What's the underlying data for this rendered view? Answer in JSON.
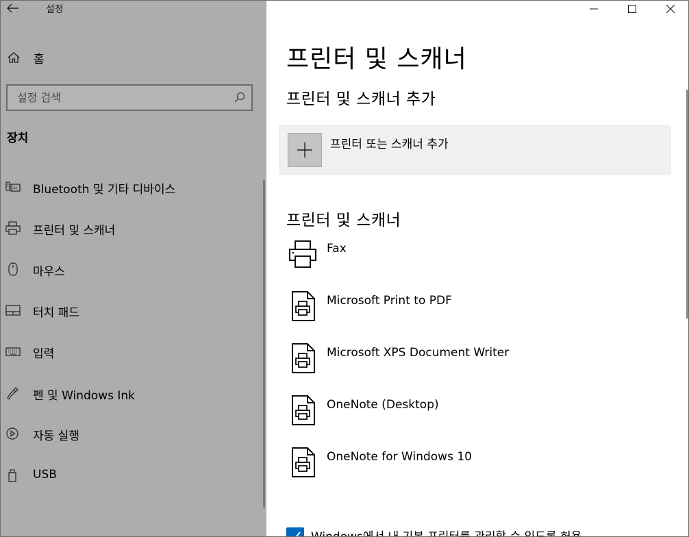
{
  "window": {
    "title": "설정",
    "accent_color": "#0067c0",
    "sidebar_color": "#adadad"
  },
  "sidebar": {
    "home_label": "홈",
    "search_placeholder": "설정 검색",
    "section_title": "장치",
    "items": [
      {
        "label": "Bluetooth 및 기타 디바이스",
        "icon": "bluetooth-devices-icon"
      },
      {
        "label": "프린터 및 스캐너",
        "icon": "printer-icon"
      },
      {
        "label": "마우스",
        "icon": "mouse-icon"
      },
      {
        "label": "터치 패드",
        "icon": "touchpad-icon"
      },
      {
        "label": "입력",
        "icon": "keyboard-icon"
      },
      {
        "label": "펜 및 Windows Ink",
        "icon": "pen-icon"
      },
      {
        "label": "자동 실행",
        "icon": "autoplay-icon"
      },
      {
        "label": "USB",
        "icon": "usb-icon"
      }
    ]
  },
  "main": {
    "page_title": "프린터 및 스캐너",
    "add_section_title": "프린터 및 스캐너 추가",
    "add_button_label": "프린터 또는 스캐너 추가",
    "list_section_title": "프린터 및 스캐너",
    "printers": [
      {
        "name": "Fax",
        "icon": "fax-printer-icon"
      },
      {
        "name": "Microsoft Print to PDF",
        "icon": "document-printer-icon"
      },
      {
        "name": "Microsoft XPS Document Writer",
        "icon": "document-printer-icon"
      },
      {
        "name": "OneNote (Desktop)",
        "icon": "document-printer-icon"
      },
      {
        "name": "OneNote for Windows 10",
        "icon": "document-printer-icon"
      }
    ],
    "manage_default_label": "Windows에서 내 기본 프린터를 관리할 수 있도록 허용",
    "manage_default_checked": true
  }
}
